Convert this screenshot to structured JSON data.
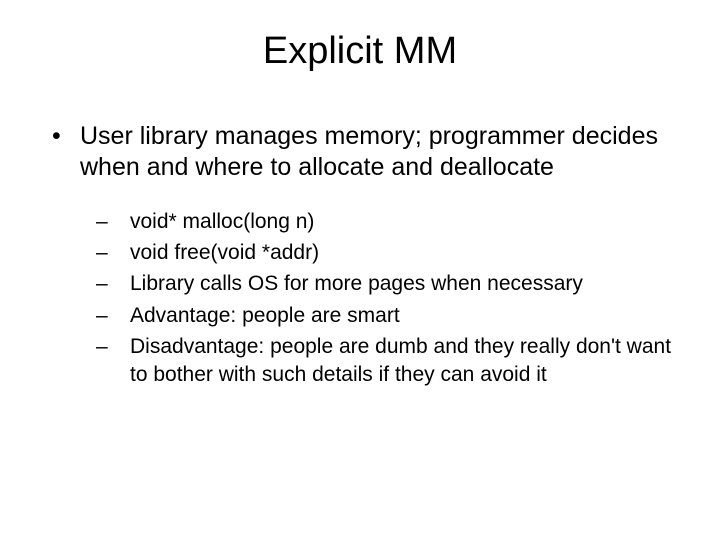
{
  "title": "Explicit MM",
  "bullet": {
    "marker": "•",
    "text": "User library manages memory; programmer decides when and where to allocate and deallocate"
  },
  "subMarker": "–",
  "subs": [
    "void* malloc(long n)",
    "void free(void *addr)",
    "Library calls OS for more pages when necessary",
    "Advantage: people are smart",
    "Disadvantage: people are dumb and they really don't want to bother with such details if they can avoid it"
  ]
}
